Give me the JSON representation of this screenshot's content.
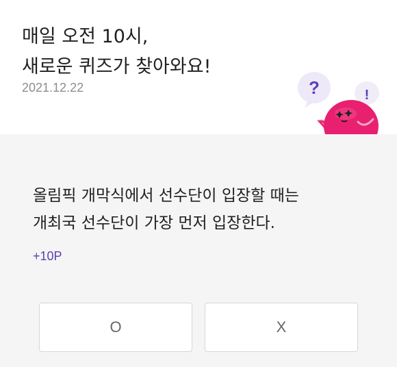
{
  "header": {
    "headline_line1": "매일 오전 10시,",
    "headline_line2": "새로운 퀴즈가 찾아와요!",
    "date": "2021.12.22",
    "mascot_icon": "quiz-mascot-icon",
    "question_mark": "?",
    "exclamation_mark": "!"
  },
  "quiz": {
    "question_line1": "올림픽 개막식에서 선수단이 입장할 때는",
    "question_line2": "개최국 선수단이 가장 먼저 입장한다.",
    "points": "+10P",
    "answers": [
      {
        "label": "O"
      },
      {
        "label": "X"
      }
    ]
  },
  "colors": {
    "accent": "#5c3fb5",
    "mascot_pink": "#e8206f",
    "bubble": "#ede9f8"
  }
}
